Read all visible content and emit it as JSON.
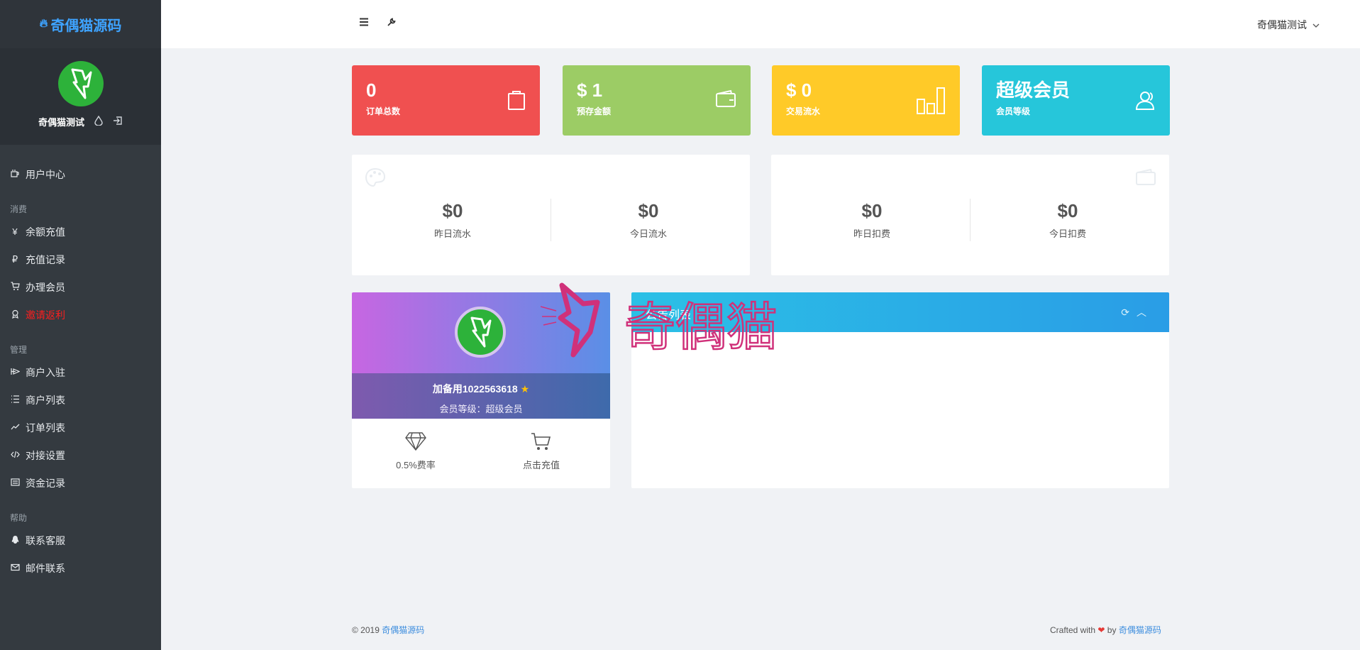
{
  "brand": {
    "name": "奇偶猫源码",
    "icon": "flame-icon"
  },
  "profile": {
    "username": "奇偶猫测试",
    "icons": [
      "droplet-icon",
      "logout-icon"
    ]
  },
  "nav": {
    "user_center": "用户中心",
    "section_consume": "消费",
    "recharge": "余额充值",
    "recharge_records": "充值记录",
    "membership": "办理会员",
    "invite_rebate": "邀请返利",
    "section_manage": "管理",
    "merchant_join": "商户入驻",
    "merchant_list": "商户列表",
    "order_list": "订单列表",
    "integration": "对接设置",
    "funds_records": "资金记录",
    "section_help": "帮助",
    "contact_support": "联系客服",
    "email_contact": "邮件联系"
  },
  "topbar": {
    "user_menu": "奇偶猫测试",
    "icons": [
      "menu-icon",
      "wrench-icon",
      "chevron-down-icon"
    ]
  },
  "stats": [
    {
      "value": "0",
      "label": "订单总数",
      "color": "#f05050",
      "icon": "clipboard-icon"
    },
    {
      "value": "$ 1",
      "label": "预存金额",
      "color": "#9ccc65",
      "icon": "wallet-icon"
    },
    {
      "value": "$ 0",
      "label": "交易流水",
      "color": "#ffca28",
      "icon": "bar-chart-icon"
    },
    {
      "value": "超级会员",
      "label": "会员等级",
      "color": "#26c6da",
      "icon": "users-icon"
    }
  ],
  "summary_left": {
    "yesterday_value": "$0",
    "yesterday_label": "昨日流水",
    "today_value": "$0",
    "today_label": "今日流水",
    "icon": "palette-icon"
  },
  "summary_right": {
    "yesterday_value": "$0",
    "yesterday_label": "昨日扣费",
    "today_value": "$0",
    "today_label": "今日扣费",
    "icon": "wallet-icon"
  },
  "member_card": {
    "name": "加备用1022563618",
    "level": "会员等级：超级会员",
    "rate_label": "0.5%费率",
    "recharge_label": "点击充值"
  },
  "notice": {
    "title": "公告列表"
  },
  "watermark": {
    "text": "奇偶猫"
  },
  "footer": {
    "copyright": "© 2019",
    "link": "奇偶猫源码",
    "crafted": "Crafted with",
    "by": "by",
    "link2": "奇偶猫源码"
  },
  "colors": {
    "sidebar": "#343a40",
    "accent": "#3ea3ff",
    "danger": "#ff1e1e"
  }
}
